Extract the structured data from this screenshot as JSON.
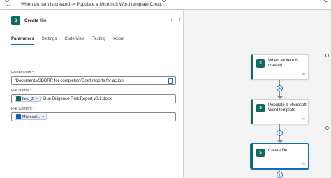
{
  "window": {
    "title": "When an item is created -> Populate a Microsoft Word template,Creat..."
  },
  "panel": {
    "title": "Create file",
    "app_icon": "sharepoint-icon",
    "tabs": [
      "Parameters",
      "Settings",
      "Code View",
      "Testing",
      "About"
    ],
    "active_tab": "Parameters",
    "fields": {
      "folder_path": {
        "label": "Folder Path *",
        "value": "/Documents/SDDRR for completion/Draft reports for action"
      },
      "file_name": {
        "label": "File Name *",
        "token": "field_2",
        "value": "Due Diligence Risk Report v0.1.docx"
      },
      "file_content": {
        "label": "File Content *",
        "token": "Microsof..."
      }
    }
  },
  "canvas": {
    "nodes": [
      {
        "label": "When an item is created",
        "icon": "sharepoint-icon"
      },
      {
        "label": "Populate a Microsoft Word template",
        "icon": "sharepoint-icon"
      },
      {
        "label": "Create file",
        "icon": "sharepoint-icon",
        "selected": true
      }
    ]
  },
  "colors": {
    "accent": "#0f6cbd",
    "sharepoint": "#0e6a5c",
    "canvas_bg": "#f3f3f3"
  }
}
